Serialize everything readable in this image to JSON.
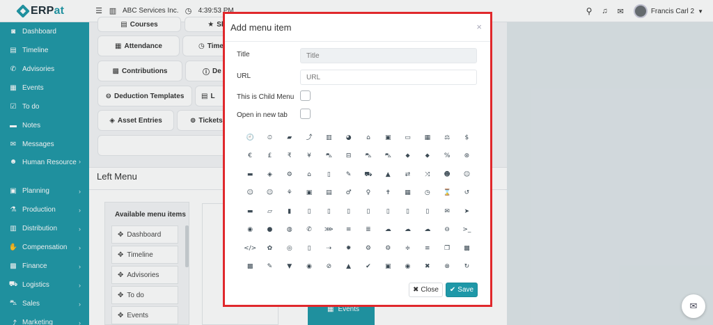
{
  "brand": {
    "text_main": "ERP",
    "text_accent": "at"
  },
  "topbar": {
    "company": "ABC Services Inc.",
    "clock": "4:39:53 PM",
    "user_name": "Francis Carl 2"
  },
  "sidebar": {
    "items": [
      {
        "label": "Dashboard",
        "icon": "dashboard-icon",
        "glyph": "◙",
        "arrow": false
      },
      {
        "label": "Timeline",
        "icon": "timeline-icon",
        "glyph": "▤",
        "arrow": false
      },
      {
        "label": "Advisories",
        "icon": "bullhorn-icon",
        "glyph": "✆",
        "arrow": false
      },
      {
        "label": "Events",
        "icon": "calendar-icon",
        "glyph": "▦",
        "arrow": false
      },
      {
        "label": "To do",
        "icon": "checkbox-icon",
        "glyph": "☑",
        "arrow": false
      },
      {
        "label": "Notes",
        "icon": "note-icon",
        "glyph": "▬",
        "arrow": false
      },
      {
        "label": "Messages",
        "icon": "envelope-icon",
        "glyph": "✉",
        "arrow": false
      },
      {
        "label": "Human Resource",
        "icon": "users-icon",
        "glyph": "☻",
        "arrow": true
      },
      {
        "label": "Planning",
        "icon": "briefcase-icon",
        "glyph": "▣",
        "arrow": true
      },
      {
        "label": "Production",
        "icon": "flask-icon",
        "glyph": "⚗",
        "arrow": true
      },
      {
        "label": "Distribution",
        "icon": "bank-icon",
        "glyph": "▥",
        "arrow": true
      },
      {
        "label": "Compensation",
        "icon": "handshake-icon",
        "glyph": "✋",
        "arrow": true
      },
      {
        "label": "Finance",
        "icon": "money-icon",
        "glyph": "▩",
        "arrow": true
      },
      {
        "label": "Logistics",
        "icon": "truck-icon",
        "glyph": "⛟",
        "arrow": true
      },
      {
        "label": "Sales",
        "icon": "cart-icon",
        "glyph": "⛍",
        "arrow": true
      },
      {
        "label": "Marketing",
        "icon": "chart-icon",
        "glyph": "⤴",
        "arrow": true
      }
    ]
  },
  "background_buttons": {
    "courses": "Courses",
    "skillsets": "Skillsets",
    "attendance": "Attendance",
    "timesheets": "Time",
    "contributions": "Contributions",
    "deductions": "De",
    "deduction_templates": "Deduction Templates",
    "l_item": "L",
    "asset_entries": "Asset Entries",
    "tickets": "Tickets"
  },
  "left_menu": {
    "title": "Left Menu",
    "available_title": "Available menu items",
    "available_items": [
      "Dashboard",
      "Timeline",
      "Advisories",
      "To do",
      "Events"
    ],
    "strip_item": "Events"
  },
  "modal": {
    "title": "Add menu item",
    "close_glyph": "×",
    "fields": {
      "title_label": "Title",
      "title_placeholder": "Title",
      "url_label": "URL",
      "url_placeholder": "URL",
      "child_label": "This is Child Menu",
      "newtab_label": "Open in new tab"
    },
    "icons": [
      "🕘",
      "⏲",
      "▰",
      "⤴",
      "▥",
      "◕",
      "⌂",
      "▣",
      "▭",
      "▦",
      "⚖",
      "$",
      "€",
      "£",
      "₹",
      "¥",
      "⛍",
      "⊟",
      "⛍",
      "⛍",
      "⬥",
      "⬥",
      "%",
      "⊛",
      "▬",
      "◈",
      "⚙",
      "⌂",
      "▯",
      "✎",
      "⛟",
      "▲",
      "⇄",
      "⤨",
      "☻",
      "☺",
      "☺",
      "☺",
      "⚘",
      "▣",
      "▤",
      "♂",
      "♀",
      "✝",
      "▦",
      "◷",
      "⌛",
      "↺",
      "▬",
      "▱",
      "▮",
      "▯",
      "▯",
      "▯",
      "▯",
      "▯",
      "▯",
      "▯",
      "✉",
      "➤",
      "◉",
      "●",
      "◍",
      "✆",
      "⋙",
      "≡",
      "≣",
      "☁",
      "☁",
      "☁",
      "⊖",
      ">_",
      "</>",
      "✿",
      "◎",
      "▯",
      "⇢",
      "✹",
      "⚙",
      "⚙",
      "≑",
      "≡",
      "❐",
      "▩",
      "▩",
      "✎",
      "▼",
      "◉",
      "⊘",
      "▲",
      "✔",
      "▣",
      "◉",
      "✖",
      "⊗",
      "↻",
      "↷",
      "↶",
      "◌",
      "◠",
      "▼",
      "●",
      "▲",
      "…",
      "⇅",
      "⇅",
      "▰",
      "◔"
    ],
    "close_button": "Close",
    "save_button": "Save"
  },
  "colors": {
    "accent": "#1f98a8",
    "highlight_border": "#e0282c"
  }
}
